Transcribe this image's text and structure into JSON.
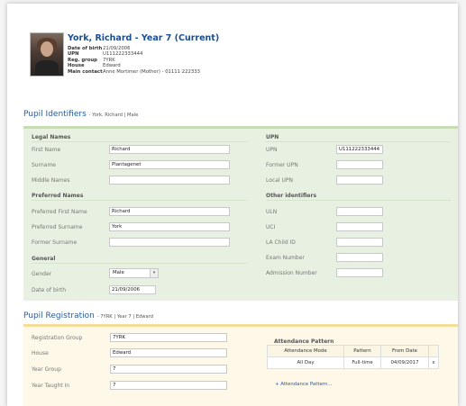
{
  "pupil": {
    "title": "York, Richard - Year 7 (Current)",
    "info": [
      {
        "key": "Date of birth",
        "value": "21/09/2006"
      },
      {
        "key": "UPN",
        "value": "U111222333444"
      },
      {
        "key": "Reg. group",
        "value": "7YRK"
      },
      {
        "key": "House",
        "value": "Edward"
      },
      {
        "key": "Main contact",
        "value": "Anne Mortimer (Mother) - 01111 222333"
      }
    ]
  },
  "identifiers": {
    "title": "Pupil Identifiers",
    "subtitle": "- York, Richard | Male",
    "legal_header": "Legal Names",
    "first_name_label": "First Name",
    "first_name": "Richard",
    "surname_label": "Surname",
    "surname": "Plantagenet",
    "middle_names_label": "Middle Names",
    "middle_names": "",
    "preferred_header": "Preferred Names",
    "pref_first_label": "Preferred First Name",
    "pref_first": "Richard",
    "pref_surname_label": "Preferred Surname",
    "pref_surname": "York",
    "former_surname_label": "Former Surname",
    "former_surname": "",
    "general_header": "General",
    "gender_label": "Gender",
    "gender": "Male",
    "dob_label": "Date of birth",
    "dob": "21/09/2006",
    "upn_header": "UPN",
    "upn_label": "UPN",
    "upn": "U111222333444",
    "former_upn_label": "Former UPN",
    "former_upn": "",
    "local_upn_label": "Local UPN",
    "local_upn": "",
    "other_header": "Other identifiers",
    "uln_label": "ULN",
    "uln": "",
    "uci_label": "UCI",
    "uci": "",
    "la_child_label": "LA Child ID",
    "la_child": "",
    "exam_label": "Exam Number",
    "exam": "",
    "admission_label": "Admission Number",
    "admission": ""
  },
  "registration": {
    "title": "Pupil Registration",
    "subtitle": "- 7YRK | Year 7 | Edward",
    "reg_group_label": "Registration Group",
    "reg_group": "7YRK",
    "house_label": "House",
    "house": "Edward",
    "year_group_label": "Year Group",
    "year_group": "7",
    "year_taught_label": "Year Taught In",
    "year_taught": "7",
    "attendance_title": "Attendance Pattern",
    "attendance_headers": [
      "Attendance Mode",
      "Pattern",
      "From Date"
    ],
    "attendance_row": {
      "mode": "All Day",
      "pattern": "Full-time",
      "from": "04/09/2017",
      "remove": "x"
    },
    "attendance_link": "+ Attendance Pattern..."
  }
}
